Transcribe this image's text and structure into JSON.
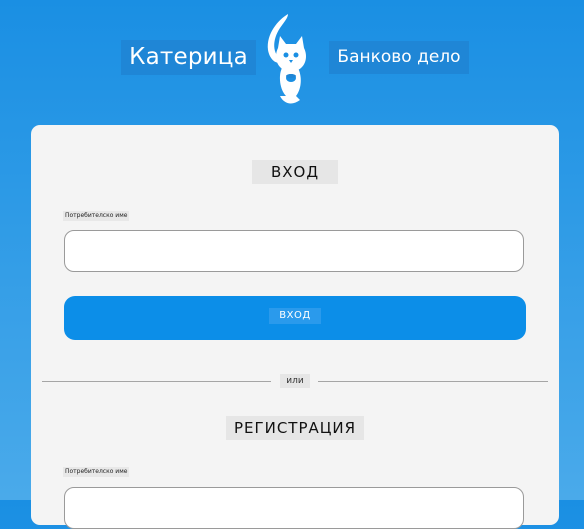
{
  "header": {
    "brand_name": "Катерица",
    "brand_subtitle": "Банково дело",
    "logo_icon": "squirrel-logo-icon"
  },
  "login": {
    "title": "ВХОД",
    "username_label": "Потребителско име",
    "username_value": "",
    "button_label": "ВХОД"
  },
  "divider": {
    "text": "или"
  },
  "register": {
    "title": "РЕГИСТРАЦИЯ",
    "username_label": "Потребителско име",
    "username_value": ""
  },
  "colors": {
    "background": "#1a8fe3",
    "card": "#f4f4f4",
    "primary_button": "#0c8ee8"
  }
}
